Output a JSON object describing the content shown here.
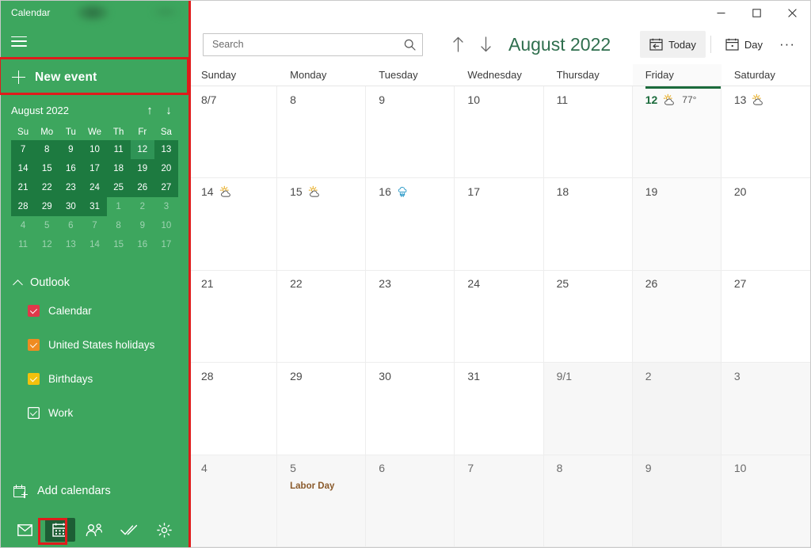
{
  "window": {
    "app_title": "Calendar",
    "controls": {
      "minimize": "minimize-icon",
      "maximize": "maximize-icon",
      "close": "close-icon"
    }
  },
  "sidebar": {
    "hamburger_icon": "hamburger-icon",
    "new_event": {
      "label": "New event",
      "icon": "plus-icon"
    },
    "mini_calendar": {
      "month_label": "August 2022",
      "prev_icon": "arrow-up-icon",
      "next_icon": "arrow-down-icon",
      "dow": [
        "Su",
        "Mo",
        "Tu",
        "We",
        "Th",
        "Fr",
        "Sa"
      ],
      "weeks": [
        [
          {
            "d": "7",
            "state": "sel"
          },
          {
            "d": "8",
            "state": "sel"
          },
          {
            "d": "9",
            "state": "sel"
          },
          {
            "d": "10",
            "state": "sel"
          },
          {
            "d": "11",
            "state": "sel"
          },
          {
            "d": "12",
            "state": "today"
          },
          {
            "d": "13",
            "state": "sel"
          }
        ],
        [
          {
            "d": "14",
            "state": "sel"
          },
          {
            "d": "15",
            "state": "sel"
          },
          {
            "d": "16",
            "state": "sel"
          },
          {
            "d": "17",
            "state": "sel"
          },
          {
            "d": "18",
            "state": "sel"
          },
          {
            "d": "19",
            "state": "sel"
          },
          {
            "d": "20",
            "state": "sel"
          }
        ],
        [
          {
            "d": "21",
            "state": "sel"
          },
          {
            "d": "22",
            "state": "sel"
          },
          {
            "d": "23",
            "state": "sel"
          },
          {
            "d": "24",
            "state": "sel"
          },
          {
            "d": "25",
            "state": "sel"
          },
          {
            "d": "26",
            "state": "sel"
          },
          {
            "d": "27",
            "state": "sel"
          }
        ],
        [
          {
            "d": "28",
            "state": "sel"
          },
          {
            "d": "29",
            "state": "sel"
          },
          {
            "d": "30",
            "state": "sel"
          },
          {
            "d": "31",
            "state": "sel"
          },
          {
            "d": "1",
            "state": "dim"
          },
          {
            "d": "2",
            "state": "dim"
          },
          {
            "d": "3",
            "state": "dim"
          }
        ],
        [
          {
            "d": "4",
            "state": "dim"
          },
          {
            "d": "5",
            "state": "dim"
          },
          {
            "d": "6",
            "state": "dim"
          },
          {
            "d": "7",
            "state": "dim"
          },
          {
            "d": "8",
            "state": "dim"
          },
          {
            "d": "9",
            "state": "dim"
          },
          {
            "d": "10",
            "state": "dim"
          }
        ],
        [
          {
            "d": "11",
            "state": "dim"
          },
          {
            "d": "12",
            "state": "dim"
          },
          {
            "d": "13",
            "state": "dim"
          },
          {
            "d": "14",
            "state": "dim"
          },
          {
            "d": "15",
            "state": "dim"
          },
          {
            "d": "16",
            "state": "dim"
          },
          {
            "d": "17",
            "state": "dim"
          }
        ]
      ]
    },
    "account": {
      "name": "Outlook",
      "collapse_icon": "chevron-up-icon"
    },
    "calendars": [
      {
        "label": "Calendar",
        "checked": true,
        "color": "#e0384a"
      },
      {
        "label": "United States holidays",
        "checked": true,
        "color": "#ef8b21"
      },
      {
        "label": "Birthdays",
        "checked": true,
        "color": "#f2c10d"
      },
      {
        "label": "Work",
        "checked": true,
        "color": "#3da65e"
      }
    ],
    "add_calendars": {
      "label": "Add calendars",
      "icon": "add-calendar-icon"
    },
    "bottom_bar": [
      {
        "name": "mail-icon",
        "active": false
      },
      {
        "name": "calendar-icon",
        "active": true
      },
      {
        "name": "people-icon",
        "active": false
      },
      {
        "name": "todo-icon",
        "active": false
      },
      {
        "name": "settings-gear-icon",
        "active": false
      }
    ]
  },
  "toolbar": {
    "search": {
      "placeholder": "Search",
      "value": "",
      "icon": "search-icon"
    },
    "prev_icon": "arrow-up-icon",
    "next_icon": "arrow-down-icon",
    "month_title": "August 2022",
    "today_button": {
      "label": "Today",
      "icon": "calendar-today-icon"
    },
    "view_button": {
      "label": "Day",
      "icon": "calendar-day-icon"
    },
    "more_button": {
      "label": "···",
      "icon": "ellipsis-icon"
    }
  },
  "calendar_grid": {
    "day_headers": [
      "Sunday",
      "Monday",
      "Tuesday",
      "Wednesday",
      "Thursday",
      "Friday",
      "Saturday"
    ],
    "today_column_index": 5,
    "weeks": [
      [
        {
          "num": "8/7",
          "month": "current"
        },
        {
          "num": "8",
          "month": "current"
        },
        {
          "num": "9",
          "month": "current"
        },
        {
          "num": "10",
          "month": "current"
        },
        {
          "num": "11",
          "month": "current"
        },
        {
          "num": "12",
          "month": "current",
          "today": true,
          "weather": "sun-cloud",
          "temp": "77°"
        },
        {
          "num": "13",
          "month": "current",
          "weather": "sun-cloud"
        }
      ],
      [
        {
          "num": "14",
          "month": "current",
          "weather": "sun-cloud"
        },
        {
          "num": "15",
          "month": "current",
          "weather": "sun-cloud"
        },
        {
          "num": "16",
          "month": "current",
          "weather": "rain"
        },
        {
          "num": "17",
          "month": "current"
        },
        {
          "num": "18",
          "month": "current"
        },
        {
          "num": "19",
          "month": "current"
        },
        {
          "num": "20",
          "month": "current"
        }
      ],
      [
        {
          "num": "21",
          "month": "current"
        },
        {
          "num": "22",
          "month": "current"
        },
        {
          "num": "23",
          "month": "current"
        },
        {
          "num": "24",
          "month": "current"
        },
        {
          "num": "25",
          "month": "current"
        },
        {
          "num": "26",
          "month": "current"
        },
        {
          "num": "27",
          "month": "current"
        }
      ],
      [
        {
          "num": "28",
          "month": "current"
        },
        {
          "num": "29",
          "month": "current"
        },
        {
          "num": "30",
          "month": "current"
        },
        {
          "num": "31",
          "month": "current"
        },
        {
          "num": "9/1",
          "month": "other"
        },
        {
          "num": "2",
          "month": "other"
        },
        {
          "num": "3",
          "month": "other"
        }
      ],
      [
        {
          "num": "4",
          "month": "other"
        },
        {
          "num": "5",
          "month": "other",
          "event": "Labor Day"
        },
        {
          "num": "6",
          "month": "other"
        },
        {
          "num": "7",
          "month": "other"
        },
        {
          "num": "8",
          "month": "other"
        },
        {
          "num": "9",
          "month": "other"
        },
        {
          "num": "10",
          "month": "other"
        }
      ]
    ]
  },
  "highlights": [
    {
      "name": "new-event-highlight",
      "color": "#e01b1b"
    },
    {
      "name": "calendar-tab-highlight",
      "color": "#e01b1b"
    }
  ]
}
